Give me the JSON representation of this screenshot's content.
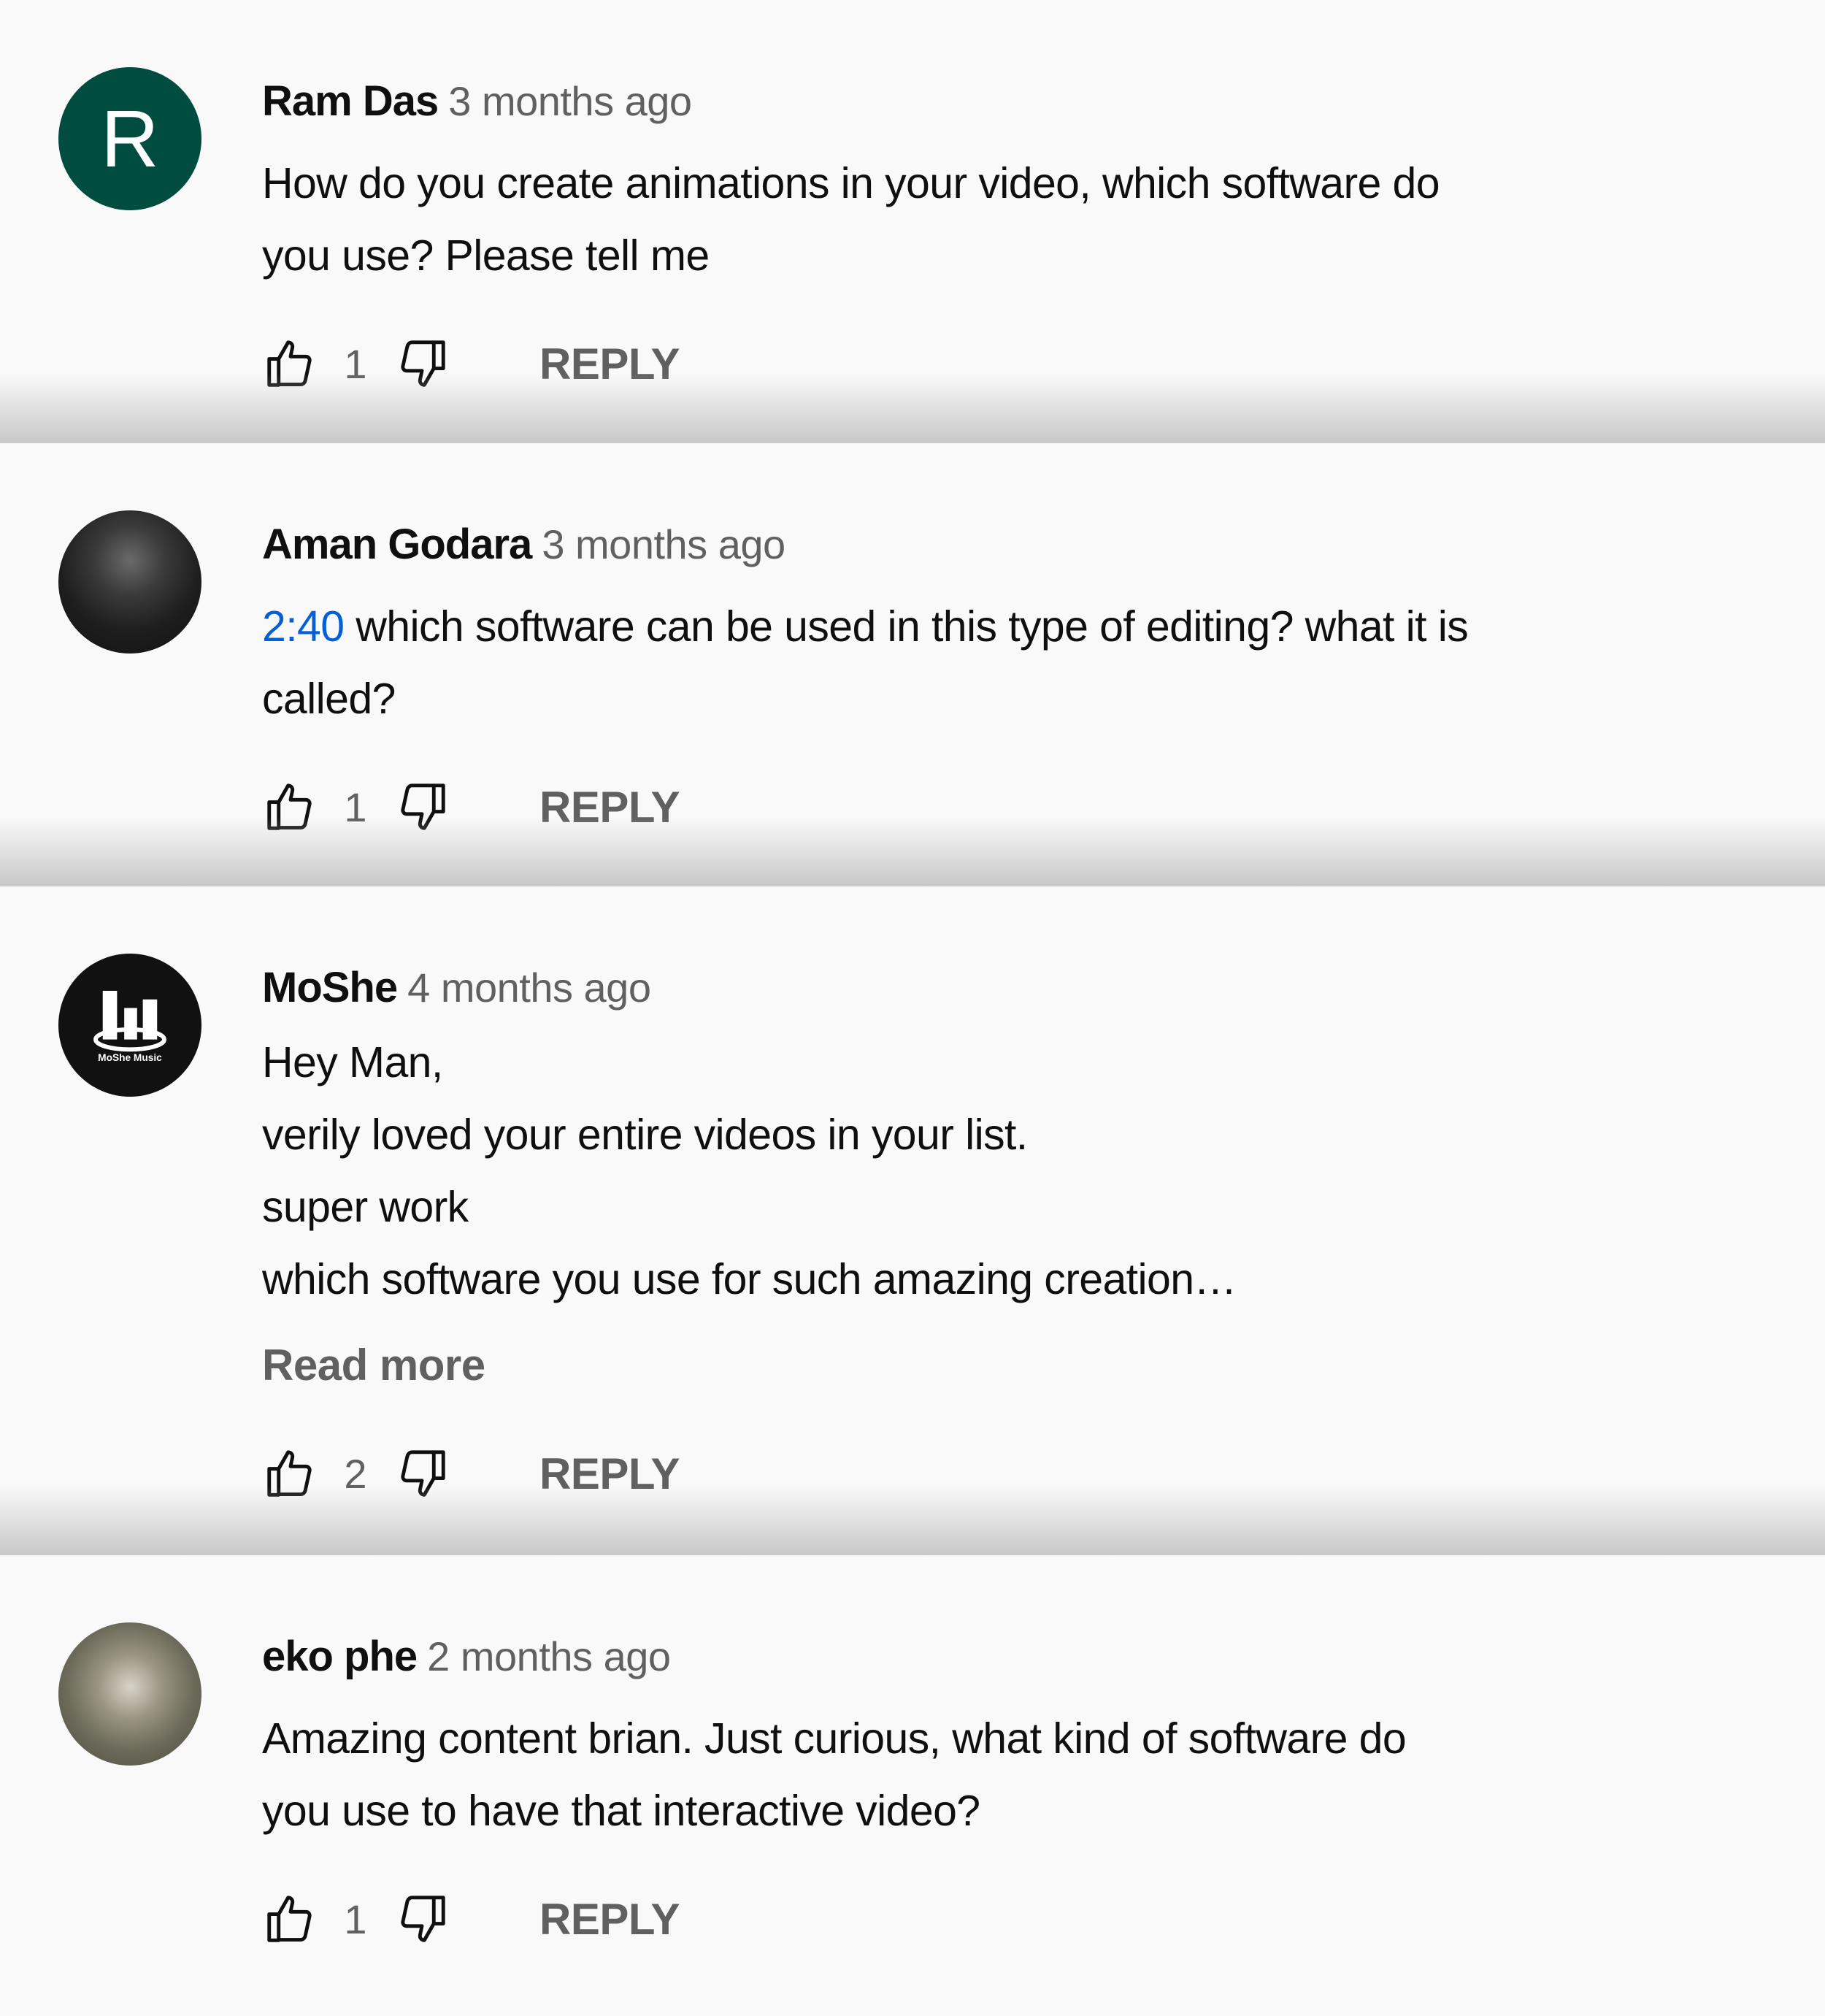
{
  "reply_label": "REPLY",
  "colors": {
    "timestamp_link": "#065fd4",
    "meta_text": "#606060",
    "avatar_r": "#004d40"
  },
  "comments": [
    {
      "author": "Ram Das",
      "time": "3 months ago",
      "avatar_letter": "R",
      "lines": [
        "How do you create animations in your video, which software do",
        "you use? Please tell me"
      ],
      "likes": "1"
    },
    {
      "author": "Aman Godara",
      "time": "3 months ago",
      "timestamp_link": "2:40",
      "lines": [
        " which software can be used in this type of editing? what it is",
        "called?"
      ],
      "likes": "1"
    },
    {
      "author": "MoShe",
      "time": "4 months ago",
      "avatar_logo_text": "MoShe Music",
      "lines": [
        "Hey Man,",
        "verily loved your entire videos in your list.",
        "super work",
        "which software you use for such amazing creation…"
      ],
      "read_more": "Read more",
      "likes": "2"
    },
    {
      "author": "eko phe",
      "time": "2 months ago",
      "lines": [
        "Amazing content brian. Just curious, what kind of software do",
        "you use to have that interactive video?"
      ],
      "likes": "1"
    }
  ]
}
